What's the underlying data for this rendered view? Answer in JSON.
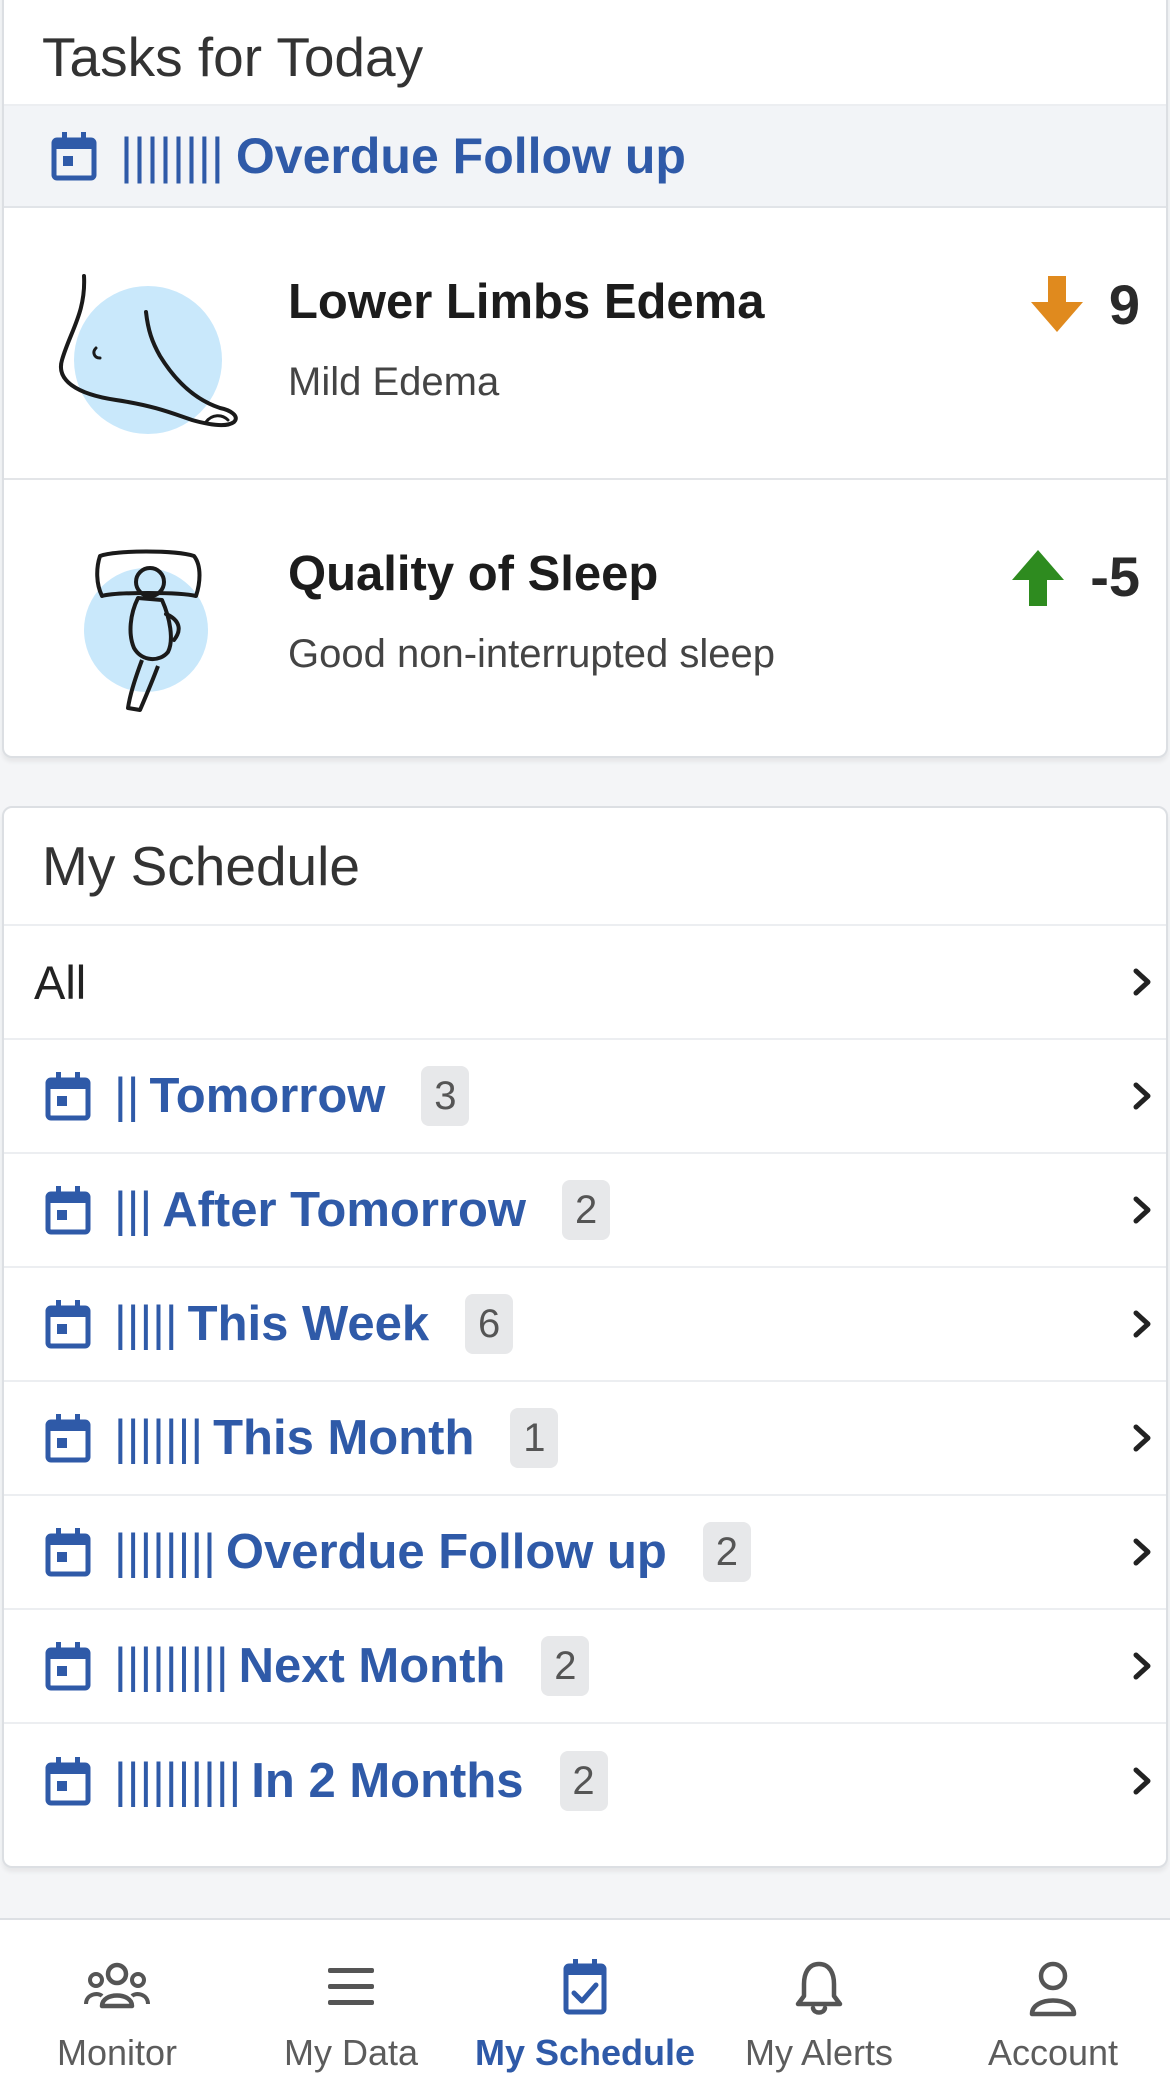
{
  "tasks": {
    "title": "Tasks for Today",
    "group": {
      "bars": "||||||||",
      "label": "Overdue Follow up"
    },
    "items": [
      {
        "title": "Lower Limbs Edema",
        "subtitle": "Mild Edema",
        "trend": "down",
        "value": "9",
        "icon": "foot-illustration"
      },
      {
        "title": "Quality of Sleep",
        "subtitle": "Good non-interrupted sleep",
        "trend": "up",
        "value": "-5",
        "icon": "sleep-illustration"
      }
    ]
  },
  "schedule": {
    "title": "My Schedule",
    "all_label": "All",
    "rows": [
      {
        "bars": "||",
        "label": "Tomorrow",
        "count": "3"
      },
      {
        "bars": "|||",
        "label": "After Tomorrow",
        "count": "2"
      },
      {
        "bars": "|||||",
        "label": "This Week",
        "count": "6"
      },
      {
        "bars": "|||||||",
        "label": "This Month",
        "count": "1"
      },
      {
        "bars": "||||||||",
        "label": "Overdue Follow up",
        "count": "2"
      },
      {
        "bars": "|||||||||",
        "label": "Next Month",
        "count": "2"
      },
      {
        "bars": "||||||||||",
        "label": "In 2 Months",
        "count": "2"
      }
    ]
  },
  "nav": {
    "items": [
      {
        "label": "Monitor",
        "icon": "people-icon"
      },
      {
        "label": "My Data",
        "icon": "menu-icon"
      },
      {
        "label": "My Schedule",
        "icon": "calendar-check-icon",
        "active": true
      },
      {
        "label": "My Alerts",
        "icon": "bell-icon"
      },
      {
        "label": "Account",
        "icon": "user-icon"
      }
    ]
  },
  "colors": {
    "accent": "#2f5aa8",
    "trend_down": "#e08a1e",
    "trend_up": "#2e8b1f",
    "illustration_bg": "#c9e8fb"
  }
}
